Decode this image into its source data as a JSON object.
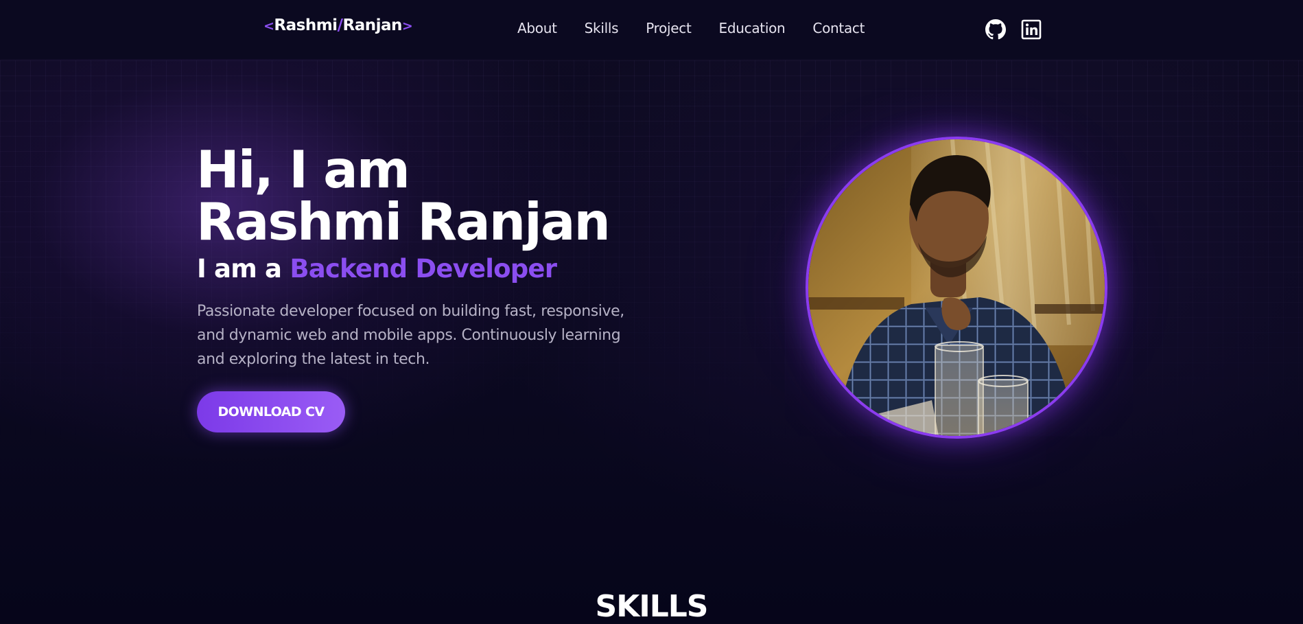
{
  "nav": {
    "logo": {
      "open": "<",
      "first": "Rashmi",
      "slash": "/",
      "last": "Ranjan",
      "close": ">"
    },
    "links": [
      "About",
      "Skills",
      "Project",
      "Education",
      "Contact"
    ],
    "socials": [
      "github-icon",
      "linkedin-icon"
    ]
  },
  "hero": {
    "greeting": "Hi, I am",
    "name": "Rashmi Ranjan",
    "role_prefix": "I am a",
    "role_highlight": "Backend Developer",
    "description": "Passionate developer focused on building fast, responsive, and dynamic web and mobile apps. Continuously learning and exploring the latest in tech.",
    "cta_label": "DOWNLOAD CV"
  },
  "sections": {
    "skills_title": "SKILLS"
  },
  "colors": {
    "background": "#08061a",
    "accent": "#8b4ef0",
    "text": "#ffffff",
    "muted_text": "#b6b2c6"
  }
}
